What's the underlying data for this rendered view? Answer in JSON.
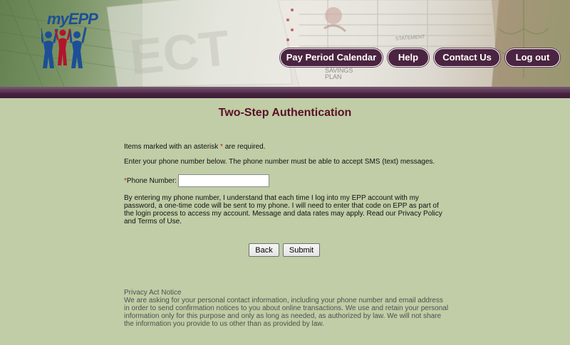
{
  "header": {
    "logo_text": "myEPP",
    "nav": [
      {
        "label": "Pay Period Calendar"
      },
      {
        "label": "Help"
      },
      {
        "label": "Contact Us"
      },
      {
        "label": "Log out"
      }
    ],
    "background_text": {
      "savings_plan": "SAVINGS\nPLAN",
      "statement": "STATEMENT"
    }
  },
  "main": {
    "title": "Two-Step Authentication",
    "required_note_prefix": "Items marked with an asterisk",
    "required_note_star": "*",
    "required_note_suffix": "are required.",
    "instruction": "Enter your phone number below. The phone number must be able to accept SMS (text) messages.",
    "phone": {
      "star": "*",
      "label": "Phone Number:",
      "value": "",
      "placeholder": ""
    },
    "consent": "By entering my phone number, I understand that each time I log into my EPP account with my password, a one-time code will be sent to my phone. I will need to enter that code on EPP as part of the login process to access my account. Message and data rates may apply. Read our Privacy Policy and Terms of Use.",
    "buttons": {
      "back": "Back",
      "submit": "Submit"
    }
  },
  "privacy": {
    "heading": "Privacy Act Notice",
    "body": "We are asking for your personal contact information, including your phone number and email address in order to send confirmation notices to you about online transactions. We use and retain your personal information only for this purpose and only as long as needed, as authorized by law. We will not share the information you provide to us other than as provided by law."
  },
  "colors": {
    "background": "#c0cda6",
    "nav_button": "#4a2440",
    "band": "#4a2442",
    "title": "#5a1028",
    "asterisk": "#c41a1a",
    "logo_blue": "#1c4f96",
    "logo_red": "#b3152b"
  },
  "icons": {
    "logo": "family-people-icon"
  }
}
